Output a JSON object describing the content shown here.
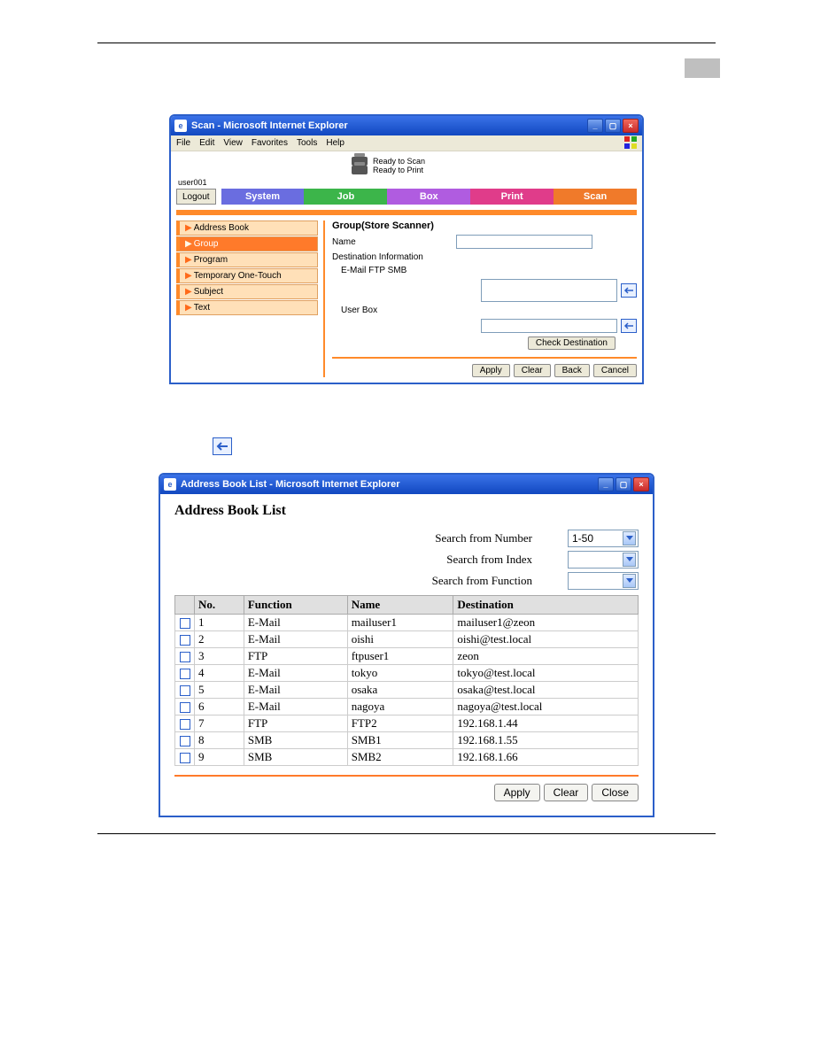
{
  "win1": {
    "title": "Scan - Microsoft Internet Explorer",
    "menus": [
      "File",
      "Edit",
      "View",
      "Favorites",
      "Tools",
      "Help"
    ],
    "status1": "Ready to Scan",
    "status2": "Ready to Print",
    "user_label": "user001",
    "logout": "Logout",
    "tabs": [
      "System",
      "Job",
      "Box",
      "Print",
      "Scan"
    ],
    "sidebar": [
      {
        "label": "Address Book",
        "active": false
      },
      {
        "label": "Group",
        "active": true
      },
      {
        "label": "Program",
        "active": false
      },
      {
        "label": "Temporary One-Touch",
        "active": false
      },
      {
        "label": "Subject",
        "active": false
      },
      {
        "label": "Text",
        "active": false
      }
    ],
    "form": {
      "section_title": "Group(Store Scanner)",
      "name_label": "Name",
      "dest_info_label": "Destination Information",
      "email_ftp_smb_label": "E-Mail FTP SMB",
      "user_box_label": "User Box",
      "check_dest_btn": "Check Destination",
      "apply": "Apply",
      "clear": "Clear",
      "back": "Back",
      "cancel": "Cancel"
    }
  },
  "win2": {
    "title": "Address Book List - Microsoft Internet Explorer",
    "page_title": "Address Book List",
    "search_number_label": "Search from Number",
    "search_number_value": "1-50",
    "search_index_label": "Search from Index",
    "search_function_label": "Search from Function",
    "columns": {
      "no": "No.",
      "func": "Function",
      "name": "Name",
      "dest": "Destination"
    },
    "rows": [
      {
        "no": "1",
        "func": "E-Mail",
        "name": "mailuser1",
        "dest": "mailuser1@zeon"
      },
      {
        "no": "2",
        "func": "E-Mail",
        "name": "oishi",
        "dest": "oishi@test.local"
      },
      {
        "no": "3",
        "func": "FTP",
        "name": "ftpuser1",
        "dest": "zeon"
      },
      {
        "no": "4",
        "func": "E-Mail",
        "name": "tokyo",
        "dest": "tokyo@test.local"
      },
      {
        "no": "5",
        "func": "E-Mail",
        "name": "osaka",
        "dest": "osaka@test.local"
      },
      {
        "no": "6",
        "func": "E-Mail",
        "name": "nagoya",
        "dest": "nagoya@test.local"
      },
      {
        "no": "7",
        "func": "FTP",
        "name": "FTP2",
        "dest": "192.168.1.44"
      },
      {
        "no": "8",
        "func": "SMB",
        "name": "SMB1",
        "dest": "192.168.1.55"
      },
      {
        "no": "9",
        "func": "SMB",
        "name": "SMB2",
        "dest": "192.168.1.66"
      }
    ],
    "apply": "Apply",
    "clear": "Clear",
    "close": "Close"
  }
}
